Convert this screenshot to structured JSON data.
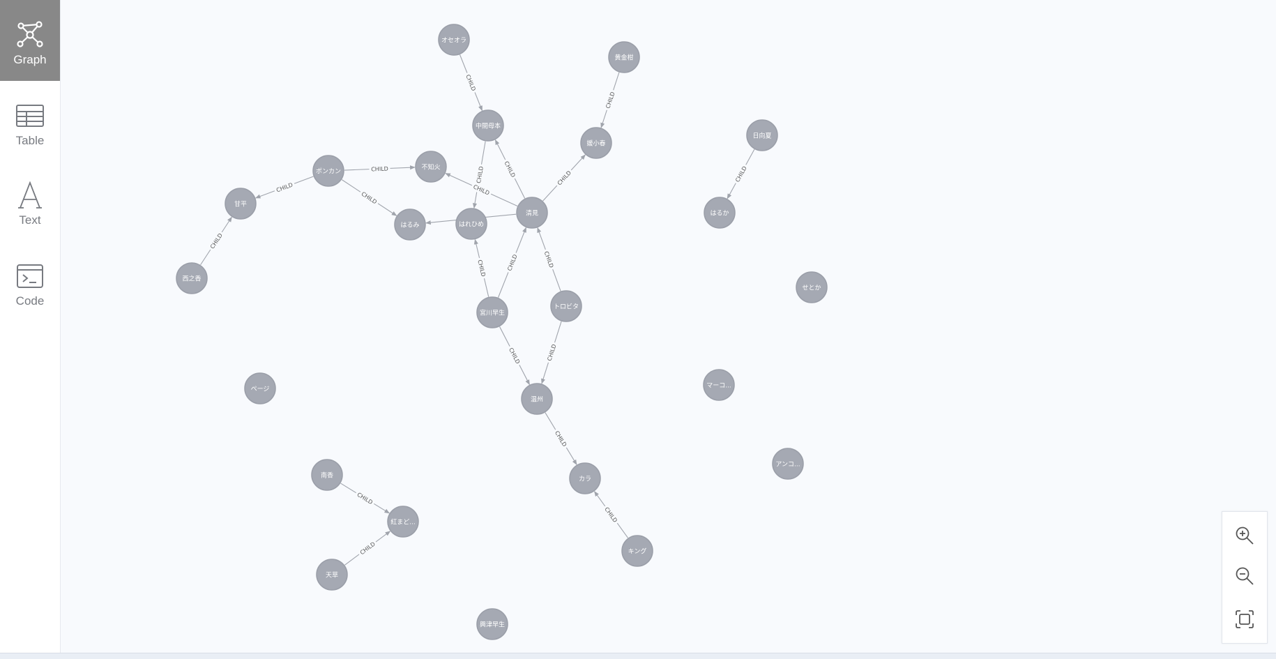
{
  "sidebar": {
    "tabs": [
      {
        "id": "graph",
        "label": "Graph",
        "icon": "graph-icon",
        "active": true
      },
      {
        "id": "table",
        "label": "Table",
        "icon": "table-icon",
        "active": false
      },
      {
        "id": "text",
        "label": "Text",
        "icon": "text-icon",
        "active": false
      },
      {
        "id": "code",
        "label": "Code",
        "icon": "code-icon",
        "active": false
      }
    ]
  },
  "graph": {
    "relationship_label": "CHILD",
    "colors": {
      "node_fill": "#a5a9b3",
      "node_stroke": "#9a9ea8",
      "edge": "#a0a4ac",
      "label_text": "#ffffff",
      "rel_text": "#555555",
      "canvas": "#f8fafd"
    },
    "nodes": [
      {
        "id": "n_oseora",
        "label": "オセオラ"
      },
      {
        "id": "n_ougonkan",
        "label": "黄金柑"
      },
      {
        "id": "n_nakama",
        "label": "中間母本"
      },
      {
        "id": "n_taiko",
        "label": "媛小春"
      },
      {
        "id": "n_hinatanatsu",
        "label": "日向夏"
      },
      {
        "id": "n_ponkan",
        "label": "ポンカン"
      },
      {
        "id": "n_shiranui",
        "label": "不知火"
      },
      {
        "id": "n_amahira",
        "label": "甘平"
      },
      {
        "id": "n_kiyomi",
        "label": "清見"
      },
      {
        "id": "n_harehime",
        "label": "はれひめ"
      },
      {
        "id": "n_harumi",
        "label": "はるみ"
      },
      {
        "id": "n_haruka",
        "label": "はるか"
      },
      {
        "id": "n_nishinoka",
        "label": "西之香"
      },
      {
        "id": "n_setoka",
        "label": "せとか"
      },
      {
        "id": "n_miyagawa",
        "label": "宮川早生"
      },
      {
        "id": "n_torovita",
        "label": "トロビタ"
      },
      {
        "id": "n_page",
        "label": "ページ"
      },
      {
        "id": "n_marcott",
        "label": "マーコ..."
      },
      {
        "id": "n_onshu",
        "label": "温州"
      },
      {
        "id": "n_ankor",
        "label": "アンコ..."
      },
      {
        "id": "n_nankou",
        "label": "南香"
      },
      {
        "id": "n_kara",
        "label": "カラ"
      },
      {
        "id": "n_benimadonna",
        "label": "紅まど..."
      },
      {
        "id": "n_amakusa",
        "label": "天草"
      },
      {
        "id": "n_king",
        "label": "キング"
      },
      {
        "id": "n_okitsu",
        "label": "興津早生"
      }
    ],
    "edges": [
      {
        "from": "n_oseora",
        "to": "n_nakama",
        "label": "CHILD"
      },
      {
        "from": "n_ougonkan",
        "to": "n_taiko",
        "label": "CHILD"
      },
      {
        "from": "n_kiyomi",
        "to": "n_taiko",
        "label": "CHILD"
      },
      {
        "from": "n_kiyomi",
        "to": "n_nakama",
        "label": "CHILD"
      },
      {
        "from": "n_nakama",
        "to": "n_harehime",
        "label": "CHILD"
      },
      {
        "from": "n_kiyomi",
        "to": "n_shiranui",
        "label": "CHILD"
      },
      {
        "from": "n_ponkan",
        "to": "n_shiranui",
        "label": "CHILD"
      },
      {
        "from": "n_ponkan",
        "to": "n_amahira",
        "label": "CHILD"
      },
      {
        "from": "n_ponkan",
        "to": "n_harumi",
        "label": "CHILD"
      },
      {
        "from": "n_kiyomi",
        "to": "n_harumi",
        "label": ""
      },
      {
        "from": "n_hinatanatsu",
        "to": "n_haruka",
        "label": "CHILD"
      },
      {
        "from": "n_nishinoka",
        "to": "n_amahira",
        "label": "CHILD"
      },
      {
        "from": "n_miyagawa",
        "to": "n_harehime",
        "label": "CHILD"
      },
      {
        "from": "n_miyagawa",
        "to": "n_kiyomi",
        "label": "CHILD"
      },
      {
        "from": "n_torovita",
        "to": "n_kiyomi",
        "label": "CHILD"
      },
      {
        "from": "n_miyagawa",
        "to": "n_onshu",
        "label": "CHILD"
      },
      {
        "from": "n_torovita",
        "to": "n_onshu",
        "label": "CHILD"
      },
      {
        "from": "n_onshu",
        "to": "n_kara",
        "label": "CHILD"
      },
      {
        "from": "n_king",
        "to": "n_kara",
        "label": "CHILD"
      },
      {
        "from": "n_nankou",
        "to": "n_benimadonna",
        "label": "CHILD"
      },
      {
        "from": "n_amakusa",
        "to": "n_benimadonna",
        "label": "CHILD"
      }
    ]
  },
  "zoom_controls": [
    {
      "id": "zoom-in",
      "icon": "zoom-in-icon"
    },
    {
      "id": "zoom-out",
      "icon": "zoom-out-icon"
    },
    {
      "id": "fit",
      "icon": "fit-to-screen-icon"
    }
  ]
}
